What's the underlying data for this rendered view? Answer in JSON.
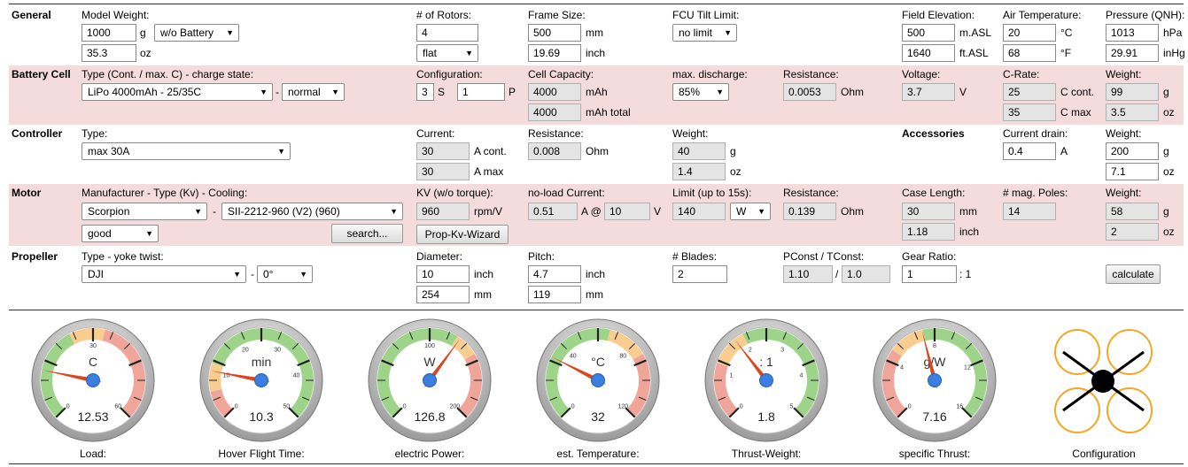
{
  "general": {
    "section": "General",
    "model_weight_label": "Model Weight:",
    "model_weight_g": "1000",
    "unit_g": "g",
    "battery_mode": "w/o Battery",
    "model_weight_oz": "35.3",
    "unit_oz": "oz",
    "rotors_label": "# of Rotors:",
    "rotors": "4",
    "layout": "flat",
    "frame_label": "Frame Size:",
    "frame_mm": "500",
    "unit_mm": "mm",
    "frame_inch": "19.69",
    "unit_inch": "inch",
    "tilt_label": "FCU Tilt Limit:",
    "tilt": "no limit",
    "elev_label": "Field Elevation:",
    "elev_m": "500",
    "unit_m": "m.ASL",
    "elev_ft": "1640",
    "unit_ft": "ft.ASL",
    "air_label": "Air Temperature:",
    "air_c": "20",
    "unit_c": "°C",
    "air_f": "68",
    "unit_f": "°F",
    "press_label": "Pressure (QNH):",
    "press_hpa": "1013",
    "unit_hpa": "hPa",
    "press_inhg": "29.91",
    "unit_inhg": "inHg"
  },
  "battery": {
    "section": "Battery Cell",
    "type_label": "Type (Cont. / max. C) - charge state:",
    "type": "LiPo 4000mAh - 25/35C",
    "dash": "-",
    "state": "normal",
    "config_label": "Configuration:",
    "s": "3",
    "s_unit": "S",
    "p": "1",
    "p_unit": "P",
    "cap_label": "Cell Capacity:",
    "cap": "4000",
    "cap_unit": "mAh",
    "cap_total": "4000",
    "cap_total_unit": "mAh total",
    "discharge_label": "max. discharge:",
    "discharge": "85%",
    "res_label": "Resistance:",
    "res": "0.0053",
    "res_unit": "Ohm",
    "volt_label": "Voltage:",
    "volt": "3.7",
    "volt_unit": "V",
    "crate_label": "C-Rate:",
    "c_cont": "25",
    "c_cont_unit": "C cont.",
    "c_max": "35",
    "c_max_unit": "C max",
    "weight_label": "Weight:",
    "weight_g": "99",
    "weight_oz": "3.5"
  },
  "controller": {
    "section": "Controller",
    "type_label": "Type:",
    "type": "max 30A",
    "current_label": "Current:",
    "cur_cont": "30",
    "cur_cont_unit": "A cont.",
    "cur_max": "30",
    "cur_max_unit": "A max",
    "res_label": "Resistance:",
    "res": "0.008",
    "res_unit": "Ohm",
    "weight_label": "Weight:",
    "weight_g": "40",
    "weight_oz": "1.4"
  },
  "accessories": {
    "section": "Accessories",
    "drain_label": "Current drain:",
    "drain": "0.4",
    "drain_unit": "A",
    "weight_label": "Weight:",
    "weight_g": "200",
    "weight_oz": "7.1"
  },
  "motor": {
    "section": "Motor",
    "type_label": "Manufacturer - Type (Kv) - Cooling:",
    "manufacturer": "Scorpion",
    "dash": "-",
    "model": "SII-2212-960 (V2) (960)",
    "cooling": "good",
    "search": "search...",
    "kv_label": "KV (w/o torque):",
    "kv": "960",
    "kv_unit": "rpm/V",
    "wizard": "Prop-Kv-Wizard",
    "noload_label": "no-load Current:",
    "noload": "0.51",
    "noload_at": "A @",
    "noload_v": "10",
    "noload_v_unit": "V",
    "limit_label": "Limit (up to 15s):",
    "limit": "140",
    "limit_unit": "W",
    "res_label": "Resistance:",
    "res": "0.139",
    "res_unit": "Ohm",
    "case_label": "Case Length:",
    "case_mm": "30",
    "case_in": "1.18",
    "poles_label": "# mag. Poles:",
    "poles": "14",
    "weight_label": "Weight:",
    "weight_g": "58",
    "weight_oz": "2"
  },
  "propeller": {
    "section": "Propeller",
    "type_label": "Type - yoke twist:",
    "type": "DJI",
    "dash": "-",
    "twist": "0°",
    "dia_label": "Diameter:",
    "dia_in": "10",
    "dia_mm": "254",
    "pitch_label": "Pitch:",
    "pitch_in": "4.7",
    "pitch_mm": "119",
    "blades_label": "# Blades:",
    "blades": "2",
    "pconst_label": "PConst / TConst:",
    "pconst": "1.10",
    "slash": "/",
    "tconst": "1.0",
    "gear_label": "Gear Ratio:",
    "gear": "1",
    "gear_suffix": ": 1",
    "calculate": "calculate"
  },
  "gauges": [
    {
      "unit": "C",
      "value": "12.53",
      "caption": "Load:",
      "min": 0,
      "max": 60,
      "needle": 12.53,
      "ticks": [
        "0",
        "30",
        "60"
      ],
      "zones": [
        [
          "#9ed48a",
          0,
          0.4
        ],
        [
          "#f9cd8f",
          0.4,
          0.55
        ],
        [
          "#f0a59a",
          0.55,
          1
        ]
      ]
    },
    {
      "unit": "min",
      "value": "10.3",
      "caption": "Hover Flight Time:",
      "min": 0,
      "max": 50,
      "needle": 10.3,
      "ticks": [
        "0",
        "10",
        "20",
        "30",
        "40",
        "50"
      ],
      "zones": [
        [
          "#f0a59a",
          0,
          0.12
        ],
        [
          "#f9cd8f",
          0.12,
          0.24
        ],
        [
          "#9ed48a",
          0.24,
          1
        ]
      ]
    },
    {
      "unit": "W",
      "value": "126.8",
      "caption": "electric Power:",
      "min": 0,
      "max": 200,
      "needle": 126.8,
      "ticks": [
        "0",
        "100",
        "200"
      ],
      "zones": [
        [
          "#9ed48a",
          0,
          0.62
        ],
        [
          "#f9cd8f",
          0.62,
          0.72
        ],
        [
          "#f0a59a",
          0.72,
          1
        ]
      ]
    },
    {
      "unit": "°C",
      "value": "32",
      "caption": "est. Temperature:",
      "min": 0,
      "max": 120,
      "needle": 32,
      "ticks": [
        "0",
        "40",
        "80",
        "120"
      ],
      "zones": [
        [
          "#9ed48a",
          0,
          0.55
        ],
        [
          "#f9cd8f",
          0.55,
          0.72
        ],
        [
          "#f0a59a",
          0.72,
          1
        ]
      ]
    },
    {
      "unit": ": 1",
      "value": "1.8",
      "caption": "Thrust-Weight:",
      "min": 0,
      "max": 5,
      "needle": 1.8,
      "ticks": [
        "0",
        "1",
        "2",
        "3",
        "4",
        "5"
      ],
      "zones": [
        [
          "#f0a59a",
          0,
          0.24
        ],
        [
          "#f9cd8f",
          0.24,
          0.4
        ],
        [
          "#9ed48a",
          0.4,
          1
        ]
      ]
    },
    {
      "unit": "g/W",
      "value": "7.16",
      "caption": "specific Thrust:",
      "min": 0,
      "max": 16,
      "needle": 7.16,
      "ticks": [
        "0",
        "4",
        "8",
        "12",
        "16"
      ],
      "zones": [
        [
          "#f0a59a",
          0,
          0.3
        ],
        [
          "#f9cd8f",
          0.3,
          0.45
        ],
        [
          "#9ed48a",
          0.45,
          1
        ]
      ]
    }
  ],
  "configuration": {
    "caption": "Configuration"
  },
  "colors": {
    "band": "#f5dcdc",
    "green": "#9ed48a",
    "yellow": "#f9cd8f",
    "red": "#f0a59a",
    "needle": "#d9471f",
    "hub": "#3a7ee0",
    "rotor": "#f5a623"
  }
}
